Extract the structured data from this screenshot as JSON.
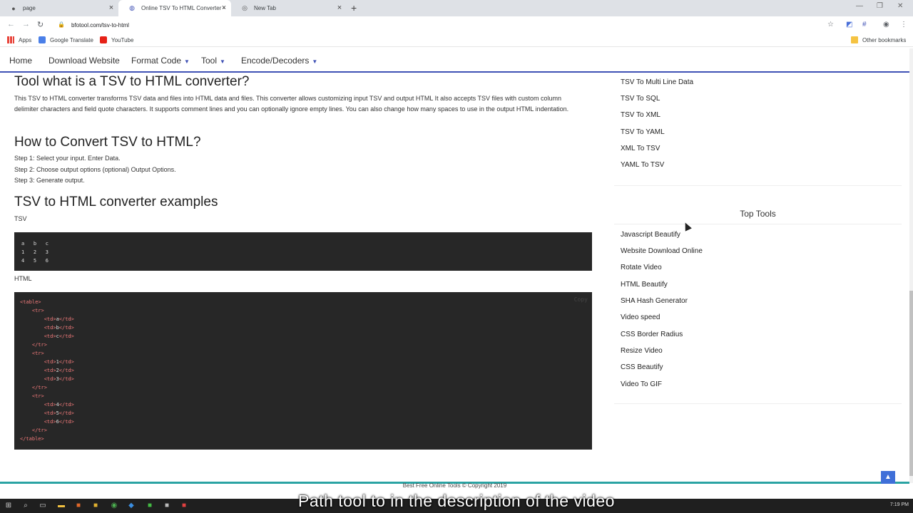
{
  "browser": {
    "tabs": [
      {
        "title": "page",
        "icon": "github-icon"
      },
      {
        "title": "Online TSV To HTML Converter -",
        "icon": "site-favicon"
      },
      {
        "title": "New Tab",
        "icon": "globe-icon"
      }
    ],
    "new_tab_label": "+",
    "url": "bfotool.com/tsv-to-html",
    "bookmarks": [
      {
        "label": "Apps"
      },
      {
        "label": "Google Translate"
      },
      {
        "label": "YouTube"
      }
    ],
    "other_bookmarks": "Other bookmarks"
  },
  "nav": {
    "items": [
      {
        "label": "Home"
      },
      {
        "label": "Download Website"
      },
      {
        "label": "Format Code"
      },
      {
        "label": "Tool"
      },
      {
        "label": "Encode/Decoders"
      }
    ]
  },
  "main": {
    "what_title": "Tool what is a TSV to HTML converter?",
    "what_text": "This TSV to HTML converter transforms TSV data and files into HTML data and files. This converter allows customizing input TSV and output HTML It also accepts TSV files with custom column delimiter characters and field quote characters. It supports comment lines and you can optionally ignore empty lines. You can also change how many spaces to use in the output HTML indentation.",
    "how_title": "How to Convert TSV to HTML?",
    "steps": [
      "Step 1: Select your input. Enter Data.",
      "Step 2: Choose output options (optional) Output Options.",
      "Step 3: Generate output."
    ],
    "examples_title": "TSV to HTML converter examples",
    "tsv_label": "TSV",
    "tsv_lines": [
      "a   b   c",
      "1   2   3",
      "4   5   6"
    ],
    "html_label": "HTML",
    "copy_label": "Copy",
    "html_lines": [
      "<table>",
      "    <tr>",
      "        <td>a</td>",
      "        <td>b</td>",
      "        <td>c</td>",
      "    </tr>",
      "    <tr>",
      "        <td>1</td>",
      "        <td>2</td>",
      "        <td>3</td>",
      "    </tr>",
      "    <tr>",
      "        <td>4</td>",
      "        <td>5</td>",
      "        <td>6</td>",
      "    </tr>",
      "</table>"
    ]
  },
  "sidebar": {
    "top_links": [
      "TSV To Multi Line Data",
      "TSV To SQL",
      "TSV To XML",
      "TSV To YAML",
      "XML To TSV",
      "YAML To TSV"
    ],
    "top_tools_title": "Top Tools",
    "top_tools": [
      "Javascript Beautify",
      "Website Download Online",
      "Rotate Video",
      "HTML Beautify",
      "SHA Hash Generator",
      "Video speed",
      "CSS Border Radius",
      "Resize Video",
      "CSS Beautify",
      "Video To GIF"
    ]
  },
  "footer": {
    "copyright": "Best Free Online Tools © Copyright 2019"
  },
  "taskbar": {
    "time": "7:19 PM"
  },
  "caption": "Path tool to in the description of the video",
  "colors": {
    "accent": "#3f51b5",
    "code_bg": "#272727",
    "tag": "#f47b7b",
    "footer": "#2aa3a3"
  }
}
